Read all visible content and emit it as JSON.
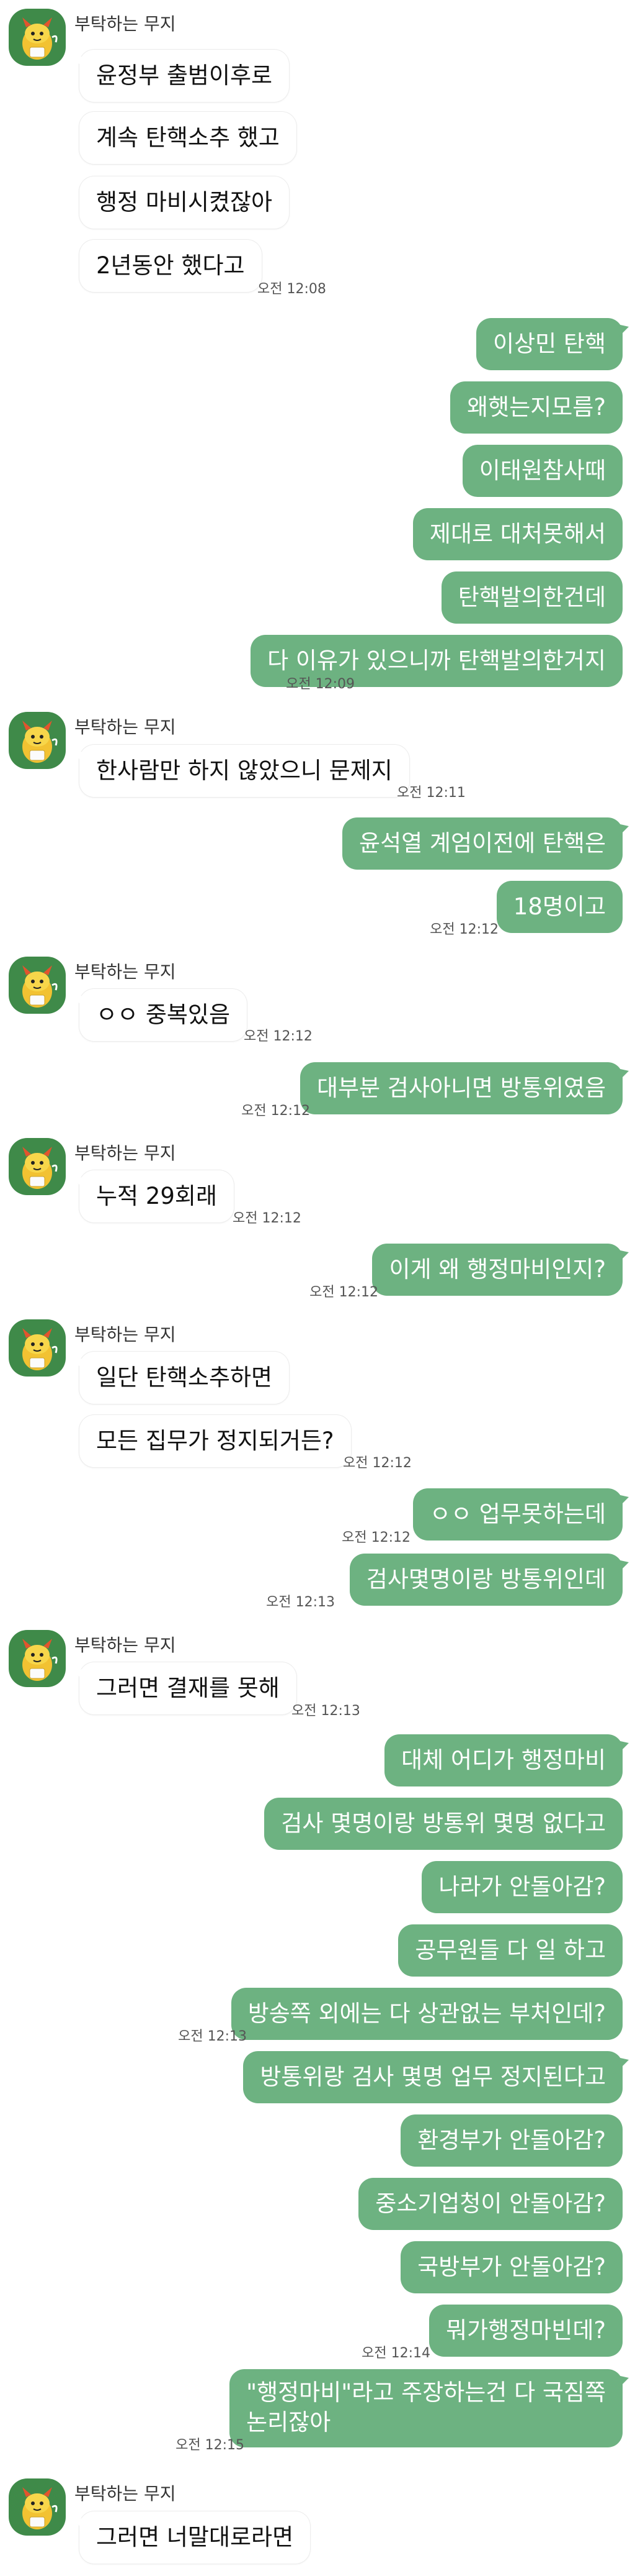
{
  "contact": {
    "name": "부탁하는 무지"
  },
  "colors": {
    "outgoing_bubble": "#6db281",
    "avatar_bg": "#3f8a49",
    "background": "#ffffff"
  },
  "groups": [
    {
      "messages": [
        "윤정부 출범이후로",
        "계속 탄핵소추 했고",
        "행정 마비시켰잖아",
        "2년동안 했다고"
      ],
      "time": "오전 12:08"
    },
    {
      "outgoing": [
        "이상민 탄핵",
        "왜햇는지모름?",
        "이태원참사때",
        "제대로 대처못해서",
        "탄핵발의한건데",
        "다 이유가 있으니까 탄핵발의한거지"
      ],
      "time": "오전 12:09"
    },
    {
      "messages": [
        "한사람만 하지 않았으니 문제지"
      ],
      "time": "오전 12:11"
    },
    {
      "outgoing": [
        "윤석열 계엄이전에 탄핵은",
        "18명이고"
      ],
      "time": "오전 12:12"
    },
    {
      "messages": [
        "ㅇㅇ 중복있음"
      ],
      "time": "오전 12:12"
    },
    {
      "outgoing": [
        "대부분 검사아니면 방통위였음"
      ],
      "time": "오전 12:12"
    },
    {
      "messages": [
        "누적 29회래"
      ],
      "time": "오전 12:12"
    },
    {
      "outgoing": [
        "이게 왜 행정마비인지?"
      ],
      "time": "오전 12:12"
    },
    {
      "messages": [
        "일단 탄핵소추하면",
        "모든 집무가 정지되거든?"
      ],
      "time": "오전 12:12"
    },
    {
      "outgoing": [
        "ㅇㅇ 업무못하는데"
      ],
      "time": "오전 12:12"
    },
    {
      "outgoing": [
        "검사몇명이랑 방통위인데"
      ],
      "time": "오전 12:13"
    },
    {
      "messages": [
        "그러면 결재를 못해"
      ],
      "time": "오전 12:13"
    },
    {
      "outgoing": [
        "대체 어디가 행정마비",
        "검사 몇명이랑 방통위 몇명 없다고",
        "나라가 안돌아감?",
        "공무원들 다 일 하고",
        "방송쪽 외에는 다 상관없는 부처인데?"
      ],
      "time": "오전 12:13"
    },
    {
      "outgoing": [
        "방통위랑 검사 몇명 업무 정지된다고",
        "환경부가 안돌아감?",
        "중소기업청이 안돌아감?",
        "국방부가 안돌아감?",
        "뭐가행정마빈데?"
      ],
      "time": "오전 12:14"
    },
    {
      "outgoing": [
        "\"행정마비\"라고 주장하는건 다 국짐쪽\n논리잖아"
      ],
      "time": "오전 12:15"
    },
    {
      "messages": [
        "그러면 너말대로라면"
      ]
    }
  ]
}
